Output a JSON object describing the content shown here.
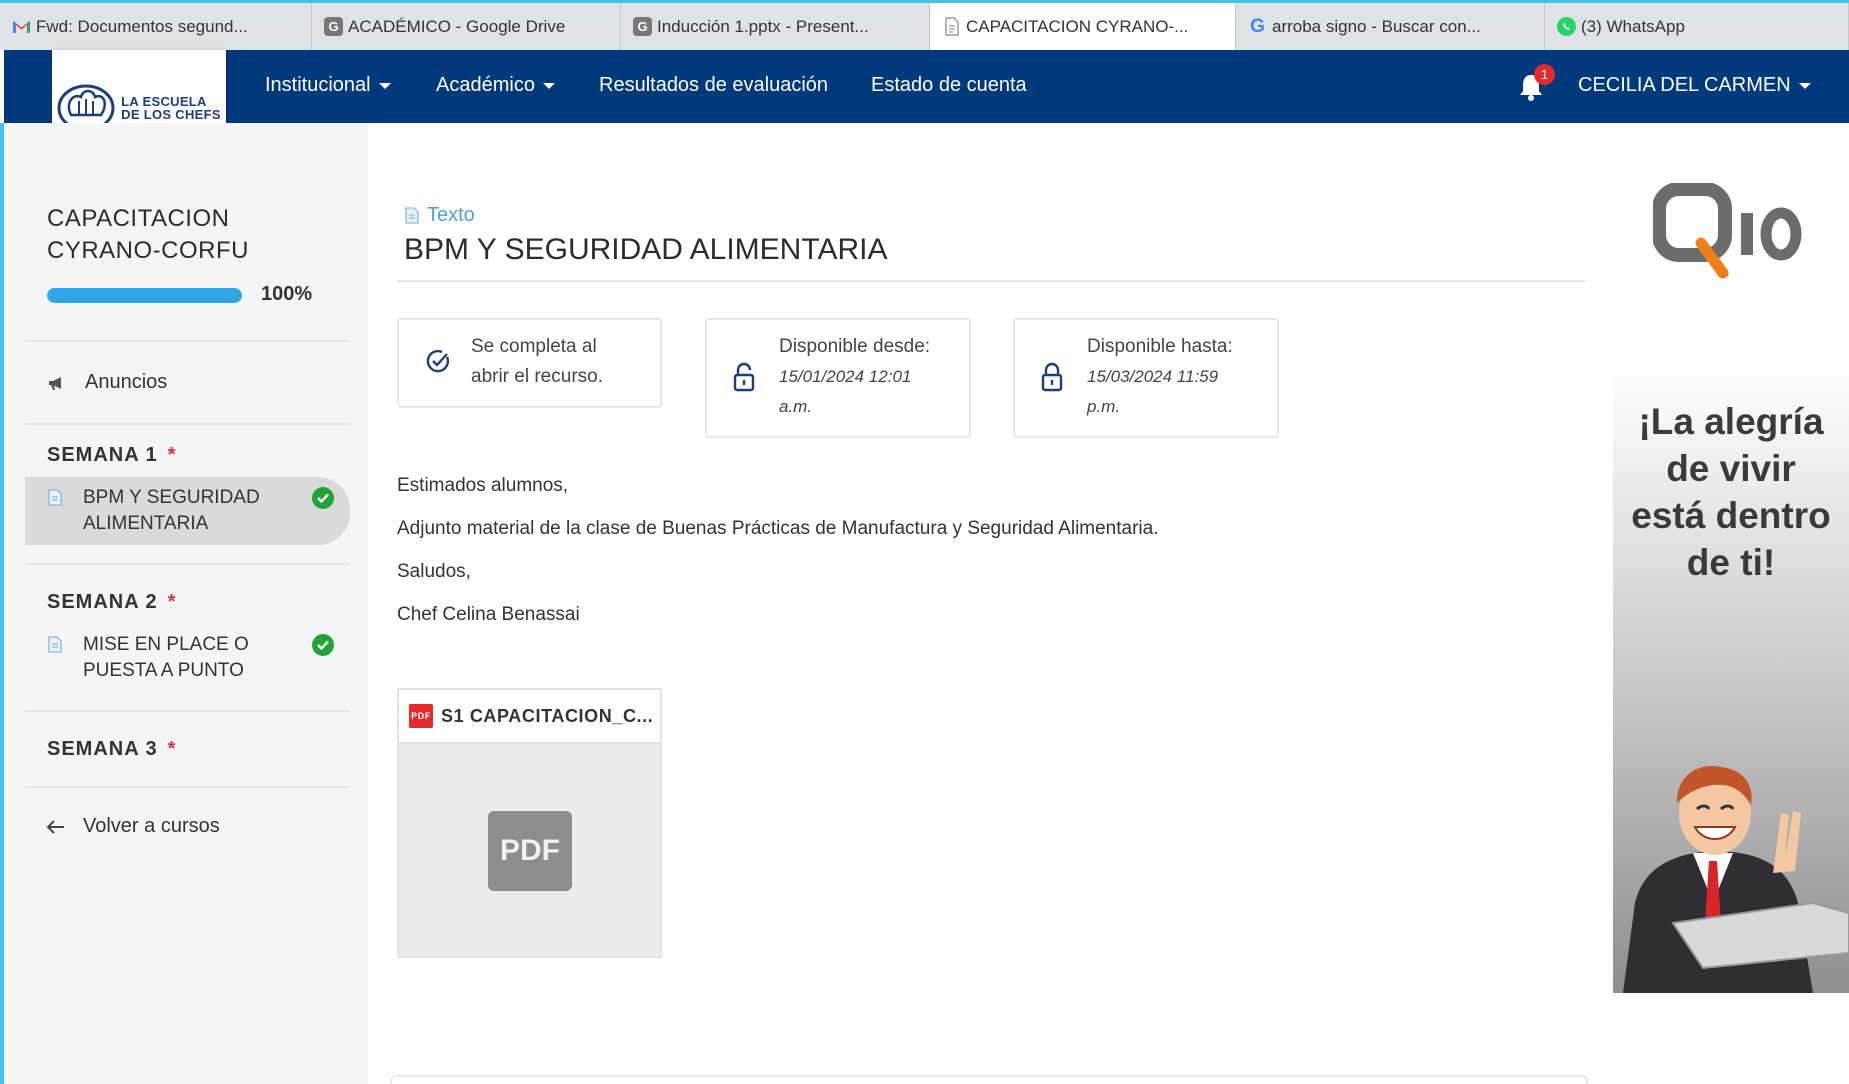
{
  "browser": {
    "tabs": [
      {
        "title": "Fwd: Documentos segund...",
        "icon": "gmail-icon"
      },
      {
        "title": "ACADÉMICO - Google Drive",
        "icon": "g-icon"
      },
      {
        "title": "Inducción 1.pptx - Present...",
        "icon": "g-icon"
      },
      {
        "title": "CAPACITACION CYRANO-...",
        "icon": "document-icon",
        "active": true
      },
      {
        "title": "arroba signo - Buscar con...",
        "icon": "google-icon"
      },
      {
        "title": "(3) WhatsApp",
        "icon": "whatsapp-icon"
      }
    ]
  },
  "header": {
    "logo": {
      "line1": "LA ESCUELA",
      "line2": "DE LOS CHEFS"
    },
    "nav": {
      "institucional": "Institucional",
      "academico": "Académico",
      "resultados": "Resultados de evaluación",
      "estado": "Estado de cuenta"
    },
    "notification_count": "1",
    "user_name": "CECILIA DEL CARMEN"
  },
  "sidebar": {
    "course_title_line1": "CAPACITACION",
    "course_title_line2": "CYRANO-CORFU",
    "progress_percent": 100,
    "progress_label": "100%",
    "anuncios": "Anuncios",
    "weeks": [
      {
        "label": "SEMANA 1",
        "required_mark": "*",
        "lessons": [
          {
            "title_line1": "BPM Y SEGURIDAD",
            "title_line2": "ALIMENTARIA",
            "completed": true,
            "active": true
          }
        ]
      },
      {
        "label": "SEMANA 2",
        "required_mark": "*",
        "lessons": [
          {
            "title_line1": "MISE EN PLACE O",
            "title_line2": "PUESTA A PUNTO",
            "completed": true,
            "active": false
          }
        ]
      },
      {
        "label": "SEMANA 3",
        "required_mark": "*",
        "lessons": []
      }
    ],
    "back_link": "Volver a cursos"
  },
  "main": {
    "type_label": "Texto",
    "title": "BPM Y SEGURIDAD ALIMENTARIA",
    "cards": {
      "completion": {
        "line1": "Se completa al",
        "line2": "abrir el recurso."
      },
      "from": {
        "label": "Disponible desde:",
        "date": "15/01/2024 12:01",
        "ampm": "a.m."
      },
      "until": {
        "label": "Disponible hasta:",
        "date": "15/03/2024 11:59",
        "ampm": "p.m."
      }
    },
    "body": [
      "Estimados alumnos,",
      "Adjunto material de la clase de Buenas Prácticas de Manufactura y Seguridad Alimentaria.",
      "Saludos,",
      "Chef Celina Benassai"
    ],
    "attachment": {
      "badge": "PDF",
      "name": "S1 CAPACITACION_C...",
      "preview": "PDF"
    }
  },
  "ad": {
    "brand": "Q10",
    "slogan_lines": [
      "¡La alegría",
      "de vivir",
      "está dentro",
      "de ti!"
    ]
  },
  "colors": {
    "nav_bg": "#003a7d",
    "accent": "#2fa6e6",
    "success": "#22a335",
    "required": "#e0323c"
  }
}
